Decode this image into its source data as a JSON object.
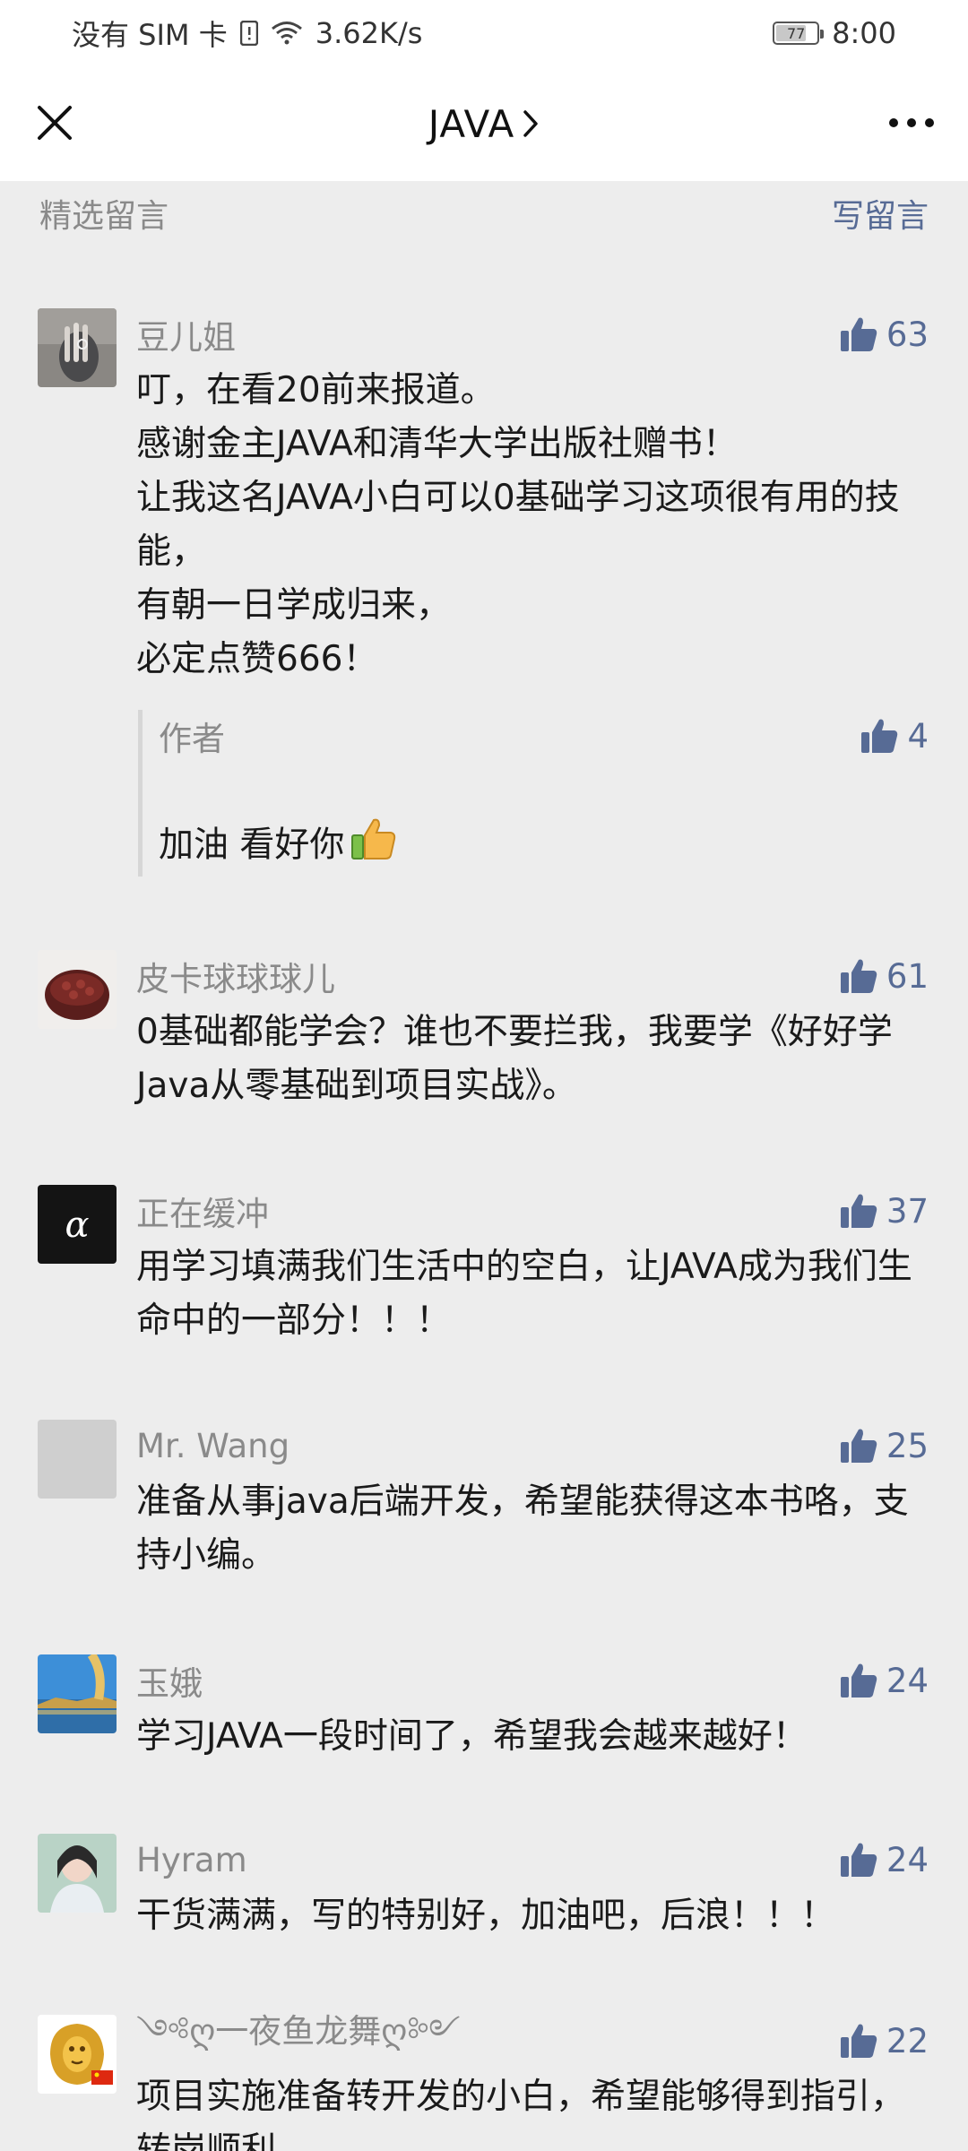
{
  "status_bar": {
    "carrier": "没有 SIM 卡",
    "speed": "3.62K/s",
    "battery": "77",
    "battery_level": 0.77,
    "time": "8:00"
  },
  "header": {
    "title": "JAVA"
  },
  "section": {
    "title": "精选留言",
    "write_label": "写留言"
  },
  "comments": [
    {
      "name": "豆儿姐",
      "likes": "63",
      "text": "叮，在看20前来报道。\n感谢金主JAVA和清华大学出版社赠书！\n让我这名JAVA小白可以0基础学习这项很有用的技能，\n有朝一日学成归来，\n必定点赞666！",
      "reply": {
        "name": "作者",
        "likes": "4",
        "text": "加油  看好你"
      }
    },
    {
      "name": "皮卡球球球儿",
      "likes": "61",
      "text": "0基础都能学会？谁也不要拦我，我要学《好好学Java从零基础到项目实战》。"
    },
    {
      "name": "正在缓冲",
      "likes": "37",
      "text": "用学习填满我们生活中的空白，让JAVA成为我们生命中的一部分！！！"
    },
    {
      "name": "Mr. Wang",
      "likes": "25",
      "text": "准备从事java后端开发，希望能获得这本书咯，支持小编。"
    },
    {
      "name": "玉娥",
      "likes": "24",
      "text": "学习JAVA一段时间了，希望我会越来越好！"
    },
    {
      "name": "Hyram",
      "likes": "24",
      "text": "干货满满，写的特别好，加油吧，后浪！！！"
    },
    {
      "name": "༺ღ一夜鱼龙舞ღ༻",
      "likes": "22",
      "text": "项目实施准备转开发的小白，希望能够得到指引，转岗顺利。"
    }
  ],
  "colors": {
    "accent": "#576b95",
    "muted": "#8a8a8a",
    "background": "#ededed"
  }
}
